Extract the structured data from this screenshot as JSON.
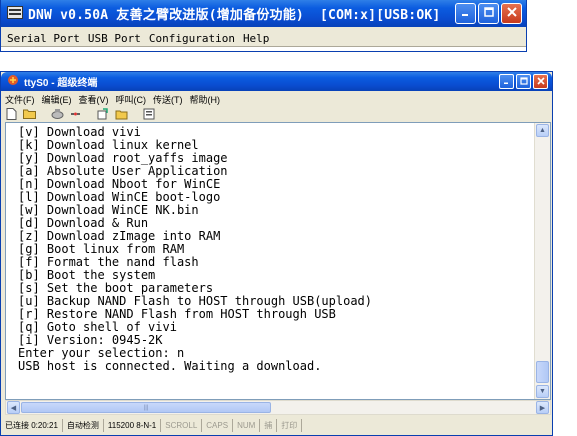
{
  "win1": {
    "title": "DNW v0.50A 友善之臂改进版(增加备份功能)",
    "status": "[COM:x][USB:OK]",
    "menu": [
      "Serial Port",
      "USB Port",
      "Configuration",
      "Help"
    ]
  },
  "win2": {
    "title": "ttyS0 - 超级终端",
    "menu": [
      "文件(F)",
      "编辑(E)",
      "查看(V)",
      "呼叫(C)",
      "传送(T)",
      "帮助(H)"
    ],
    "terminal_lines": [
      "[v] Download vivi",
      "[k] Download linux kernel",
      "[y] Download root_yaffs image",
      "[a] Absolute User Application",
      "[n] Download Nboot for WinCE",
      "[l] Download WinCE boot-logo",
      "[w] Download WinCE NK.bin",
      "[d] Download & Run",
      "[z] Download zImage into RAM",
      "[g] Boot linux from RAM",
      "[f] Format the nand flash",
      "[b] Boot the system",
      "[s] Set the boot parameters",
      "[u] Backup NAND Flash to HOST through USB(upload)",
      "[r] Restore NAND Flash from HOST through USB",
      "[q] Goto shell of vivi",
      "[i] Version: 0945-2K",
      "Enter your selection: n",
      "USB host is connected. Waiting a download."
    ],
    "status": {
      "connected": "已连接 0:20:21",
      "detect": "自动检测",
      "baud": "115200 8-N-1",
      "scroll": "SCROLL",
      "caps": "CAPS",
      "num": "NUM",
      "capture": "捕",
      "print": "打印"
    }
  },
  "colors": {
    "titlebar": "#0a4cd0",
    "window_bg": "#ece9d8",
    "close_btn": "#c73a1d"
  }
}
